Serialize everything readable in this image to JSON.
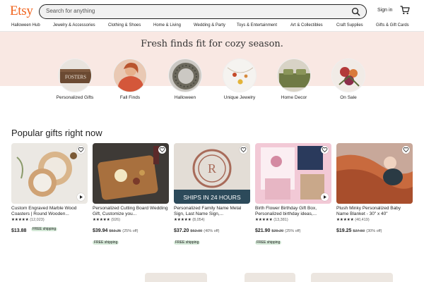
{
  "header": {
    "logo": "Etsy",
    "search_placeholder": "Search for anything",
    "signin": "Sign in"
  },
  "categories": [
    "Halloween Hub",
    "Jewelry & Accessories",
    "Clothing & Shoes",
    "Home & Living",
    "Wedding & Party",
    "Toys & Entertainment",
    "Art & Collectibles",
    "Craft Supplies",
    "Gifts & Gift Cards"
  ],
  "hero": {
    "title": "Fresh finds fit for cozy season.",
    "items": [
      {
        "label": "Personalized Gifts",
        "icon": "personalized-gifts-image"
      },
      {
        "label": "Fall Finds",
        "icon": "fall-finds-image"
      },
      {
        "label": "Halloween",
        "icon": "halloween-wreath-image"
      },
      {
        "label": "Unique Jewelry",
        "icon": "jewelry-image"
      },
      {
        "label": "Home Decor",
        "icon": "home-decor-image"
      },
      {
        "label": "On Sale",
        "icon": "on-sale-image"
      }
    ],
    "fosters_sign": "FOSTERS"
  },
  "popular": {
    "title": "Popular gifts right now",
    "cards": [
      {
        "title": "Custom Engraved Marble Wood Coasters | Round Wooden...",
        "stars": "★★★★★",
        "count": "(12,023)",
        "price": "$13.88",
        "original": "",
        "discount": "",
        "badge": "FREE shipping",
        "has_video": true
      },
      {
        "title": "Personalized Cutting Board Wedding Gift, Customize you...",
        "stars": "★★★★★",
        "count": "(926)",
        "price": "$39.94",
        "original": "$53.25",
        "discount": "(25% off)",
        "badge": "FREE shipping",
        "has_video": false
      },
      {
        "title": "Personalized Family Name Metal Sign, Last Name Sign,...",
        "stars": "★★★★★",
        "count": "(8,054)",
        "price": "$37.20",
        "original": "$62.00",
        "discount": "(40% off)",
        "badge": "FREE shipping",
        "has_video": false,
        "overlay": "SHIPS IN 24 HOURS"
      },
      {
        "title": "Birth Flower Birthday Gift Box, Personalized birthday ideas,...",
        "stars": "★★★★★",
        "count": "(13,381)",
        "price": "$21.90",
        "original": "$29.20",
        "discount": "(25% off)",
        "badge": "FREE shipping",
        "has_video": true
      },
      {
        "title": "Plush Minky Personalized Baby Name Blanket - 30\" x 40\"",
        "stars": "★★★★★",
        "count": "(40,419)",
        "price": "$19.25",
        "original": "$27.50",
        "discount": "(30% off)",
        "badge": "",
        "has_video": false
      }
    ]
  },
  "colors": {
    "brand": "#f1641e",
    "hero_bg": "#f9e8e3",
    "free_ship_bg": "#d4e9d7"
  }
}
